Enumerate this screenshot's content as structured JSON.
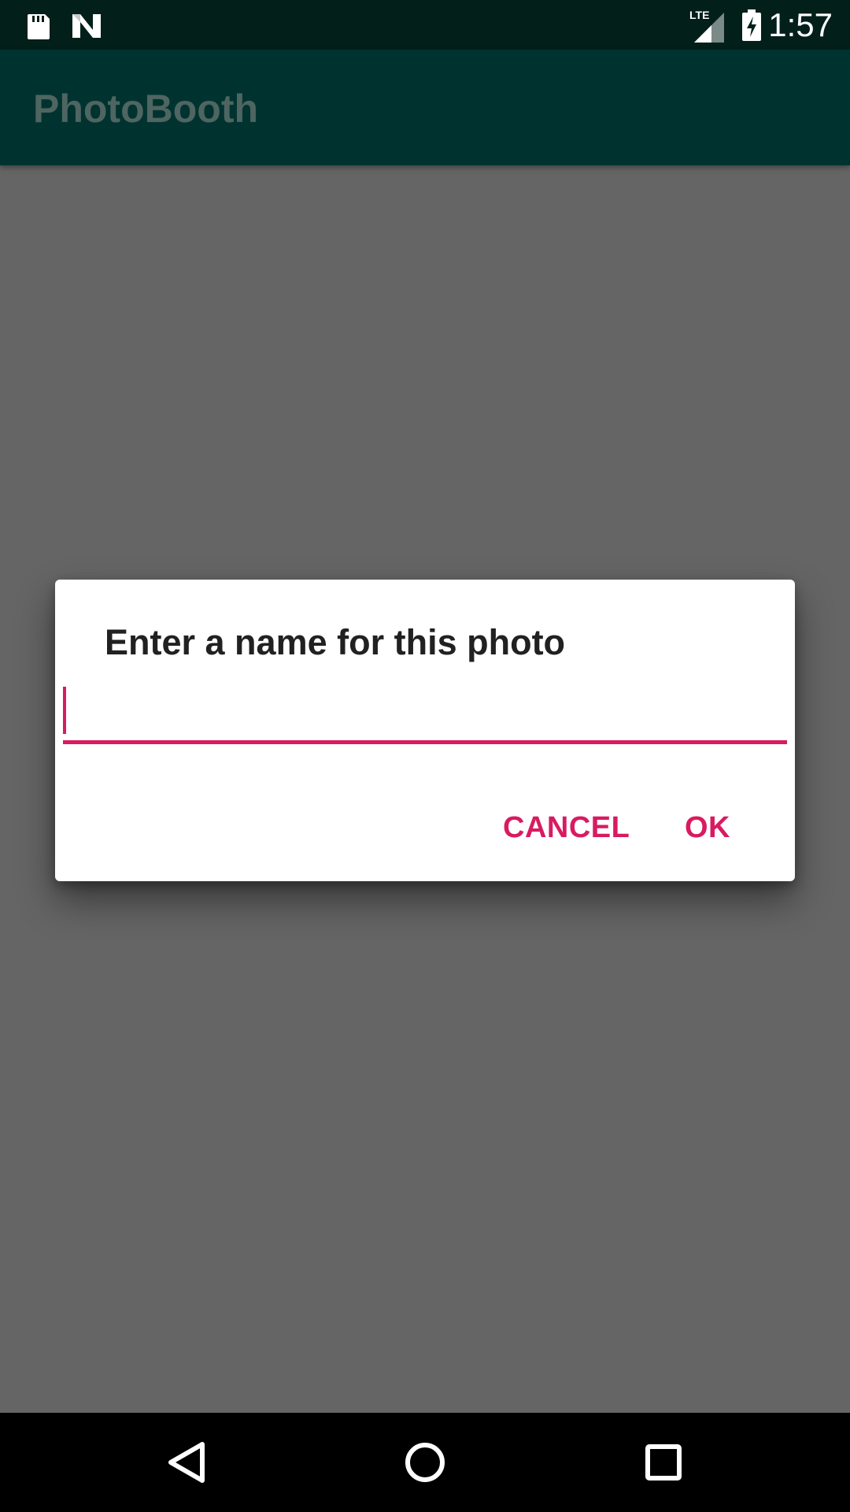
{
  "status_bar": {
    "time": "1:57",
    "network_label": "LTE",
    "icons": [
      "sd-card-icon",
      "n-icon",
      "signal-icon",
      "battery-charging-icon"
    ]
  },
  "app_bar": {
    "title": "PhotoBooth"
  },
  "dialog": {
    "title": "Enter a name for this photo",
    "input_value": "",
    "cancel_label": "CANCEL",
    "ok_label": "OK"
  },
  "nav_bar": {
    "icons": [
      "back-icon",
      "home-icon",
      "recents-icon"
    ]
  },
  "colors": {
    "status_bar": "#031f1a",
    "app_bar": "#00332f",
    "scrim_background": "#656565",
    "accent": "#d81b60",
    "dialog_background": "#ffffff",
    "nav_bar": "#000000"
  }
}
